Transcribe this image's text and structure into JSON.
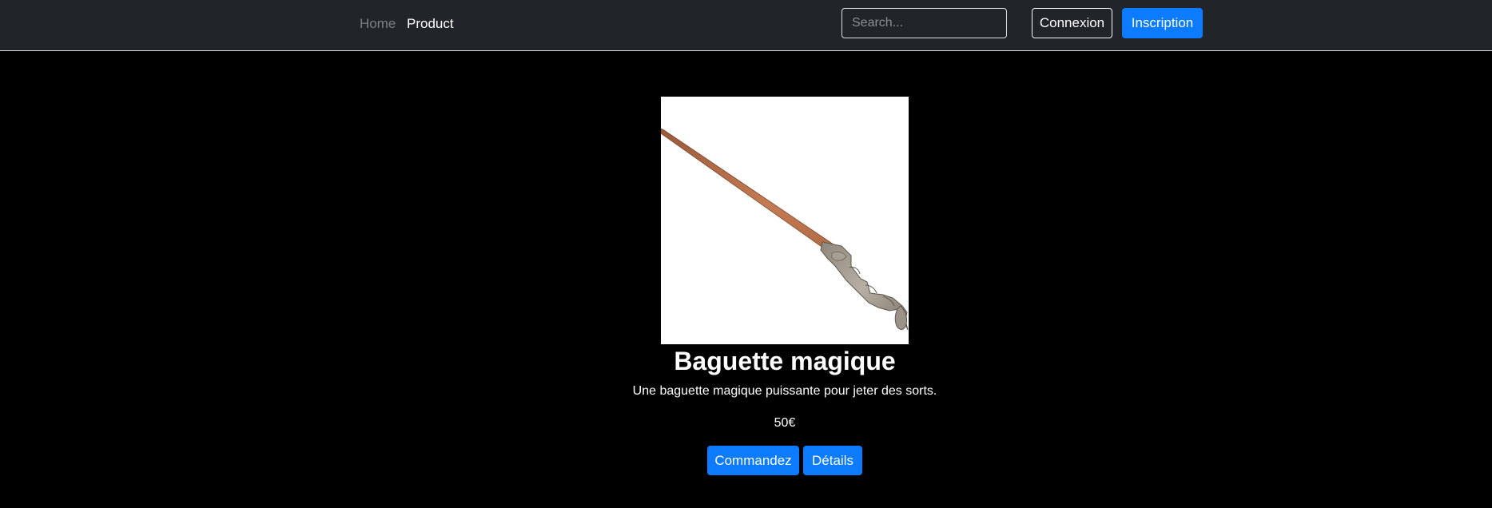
{
  "nav": {
    "links": [
      {
        "label": "Home"
      },
      {
        "label": "Product"
      }
    ],
    "search": {
      "placeholder": "Search...",
      "value": ""
    },
    "login_label": "Connexion",
    "signup_label": "Inscription"
  },
  "product": {
    "image_icon": "magic-wand",
    "title": "Baguette magique",
    "description": "Une baguette magique puissante pour jeter des sorts.",
    "price": "50€",
    "order_label": "Commandez",
    "details_label": "Détails"
  },
  "colors": {
    "navbar_bg": "#212529",
    "page_bg": "#000000",
    "primary": "#0d7bff",
    "nav_inactive": "#7b7f84",
    "text": "#ffffff"
  }
}
